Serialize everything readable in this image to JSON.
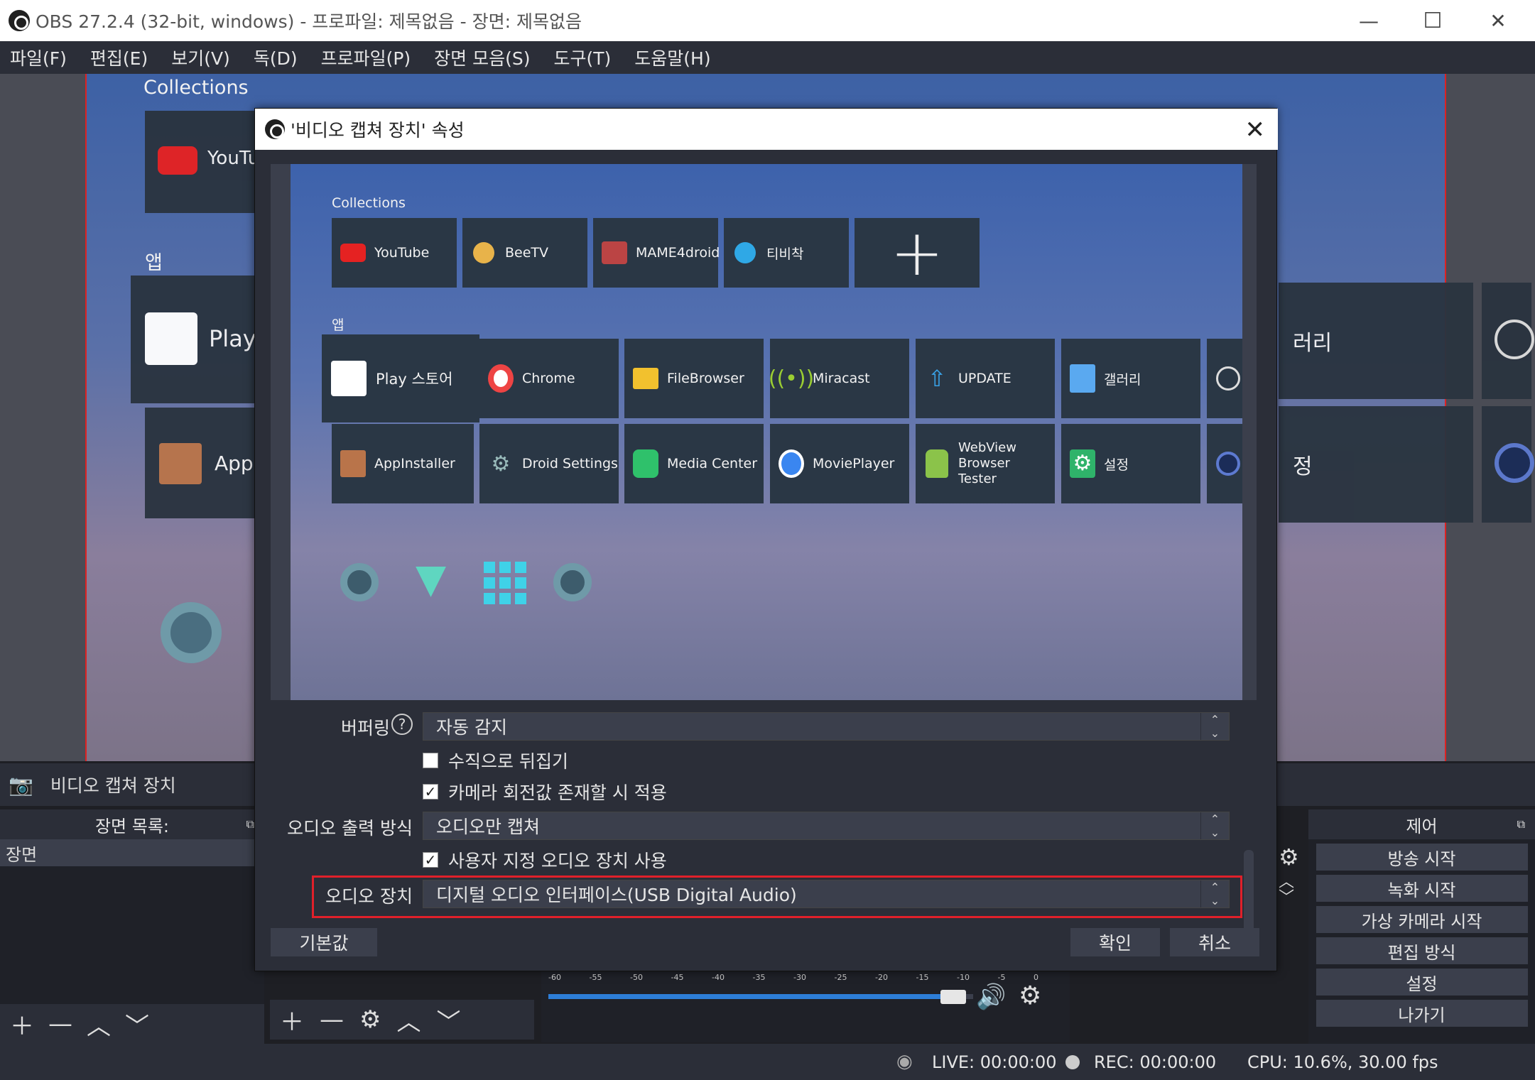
{
  "window": {
    "title": "OBS 27.2.4 (32-bit, windows) - 프로파일: 제목없음 - 장면: 제목없음",
    "minimize_icon": "—",
    "maximize_icon": "☐",
    "close_icon": "✕"
  },
  "menu": [
    "파일(F)",
    "편집(E)",
    "보기(V)",
    "독(D)",
    "프로파일(P)",
    "장면 모음(S)",
    "도구(T)",
    "도움말(H)"
  ],
  "background_preview": {
    "collections_label": "Collections",
    "apps_label": "앱",
    "youtube_partial": "YouTub",
    "play_partial": "Play :",
    "appinstaller_partial": "AppIr",
    "gallery_partial": "러리",
    "settings_partial": "정"
  },
  "source_strip": {
    "label": "비디오 캡쳐 장치"
  },
  "scenes_dock": {
    "title": "장면 목록:",
    "items": [
      "장면"
    ]
  },
  "controls_dock": {
    "title": "제어",
    "buttons": [
      "방송 시작",
      "녹화 시작",
      "가상 카메라 시작",
      "편집 방식",
      "설정",
      "나가기"
    ]
  },
  "status": {
    "live": "LIVE: 00:00:00",
    "rec": "REC: 00:00:00",
    "cpu": "CPU: 10.6%, 30.00 fps"
  },
  "dialog": {
    "title": "'비디오 캡쳐 장치' 속성",
    "close_icon": "✕",
    "preview": {
      "collections_label": "Collections",
      "apps_label": "앱",
      "collections": [
        "YouTube",
        "BeeTV",
        "MAME4droid",
        "티비착"
      ],
      "apps_row1": [
        "Play 스토어",
        "Chrome",
        "FileBrowser",
        "Miracast",
        "UPDATE",
        "갤러리"
      ],
      "apps_row2": [
        "AppInstaller",
        "Droid Settings",
        "Media Center",
        "MoviePlayer",
        "WebView Browser Tester",
        "설정"
      ]
    },
    "buffering_label": "버퍼링",
    "buffering_value": "자동 감지",
    "flip_vertical_label": "수직으로 뒤집기",
    "flip_vertical_checked": false,
    "camera_rotation_label": "카메라 회전값 존재할 시 적용",
    "camera_rotation_checked": true,
    "audio_output_label": "오디오 출력 방식",
    "audio_output_value": "오디오만 캡쳐",
    "custom_audio_label": "사용자 지정 오디오 장치 사용",
    "custom_audio_checked": true,
    "audio_device_label": "오디오 장치",
    "audio_device_value": "디지털 오디오 인터페이스(USB Digital Audio)",
    "defaults_button": "기본값",
    "ok_button": "확인",
    "cancel_button": "취소"
  },
  "mixer": {
    "ticks": [
      "-60",
      "-55",
      "-50",
      "-45",
      "-40",
      "-35",
      "-30",
      "-25",
      "-20",
      "-15",
      "-10",
      "-5",
      "0"
    ],
    "volume": 0.97
  },
  "colors": {
    "accent_blue": "#2d7ed8",
    "highlight_red": "#e0202a",
    "panel": "#2b2e38"
  }
}
